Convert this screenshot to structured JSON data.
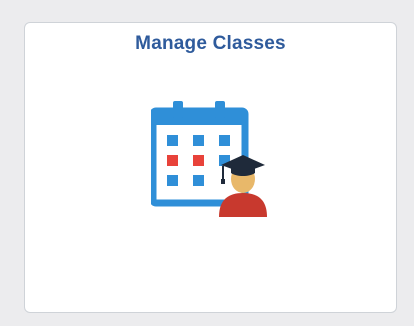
{
  "tile": {
    "title": "Manage Classes",
    "icon": "calendar-graduate-icon"
  },
  "colors": {
    "page_background": "#ececee",
    "tile_background": "#ffffff",
    "title": "#2f5b9c",
    "calendar_blue": "#2f8fd8",
    "calendar_red": "#e8423a",
    "mortarboard": "#1f2a3a",
    "face": "#e8b86a",
    "gown": "#c8392e"
  }
}
